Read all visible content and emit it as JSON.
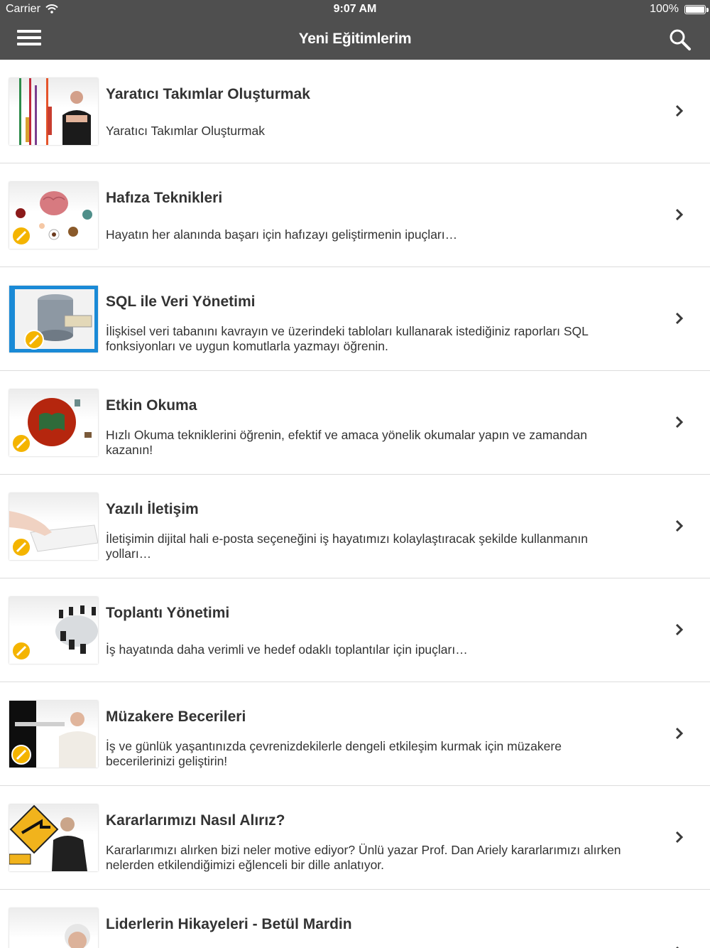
{
  "status_bar": {
    "carrier": "Carrier",
    "time": "9:07 AM",
    "battery": "100%"
  },
  "nav": {
    "title": "Yeni Eğitimlerim",
    "menu_icon": "hamburger-menu-icon",
    "search_icon": "search-icon"
  },
  "courses": [
    {
      "title": "Yaratıcı Takımlar Oluşturmak",
      "description": "Yaratıcı Takımlar Oluşturmak",
      "thumb": "creative-teams-thumbnail"
    },
    {
      "title": "Hafıza Teknikleri",
      "description": "Hayatın her alanında başarı için hafızayı geliştirmenin ipuçları…",
      "thumb": "memory-techniques-thumbnail"
    },
    {
      "title": "SQL ile Veri Yönetimi",
      "description": "İlişkisel veri tabanını kavrayın ve üzerindeki tabloları kullanarak istediğiniz raporları SQL fonksiyonları ve uygun komutlarla yazmayı öğrenin.",
      "thumb": "sql-database-thumbnail"
    },
    {
      "title": "Etkin Okuma",
      "description": "Hızlı Okuma tekniklerini öğrenin, efektif ve amaca yönelik okumalar yapın ve zamandan kazanın!",
      "thumb": "effective-reading-thumbnail"
    },
    {
      "title": "Yazılı İletişim",
      "description": "İletişimin dijital hali e-posta seçeneğini iş hayatımızı kolaylaştıracak şekilde kullanmanın yolları…",
      "thumb": "written-communication-thumbnail"
    },
    {
      "title": "Toplantı Yönetimi",
      "description": "İş hayatında daha verimli ve hedef odaklı toplantılar için ipuçları…",
      "thumb": "meeting-management-thumbnail"
    },
    {
      "title": "Müzakere Becerileri",
      "description": "İş ve günlük yaşantınızda çevrenizdekilerle dengeli etkileşim kurmak için müzakere becerilerinizi geliştirin!",
      "thumb": "negotiation-skills-thumbnail"
    },
    {
      "title": "Kararlarımızı Nasıl Alırız?",
      "description": "Kararlarımızı alırken bizi neler motive ediyor? Ünlü yazar Prof. Dan Ariely kararlarımızı alırken nelerden etkilendiğimizi eğlenceli bir dille anlatıyor.",
      "thumb": "decision-making-thumbnail"
    },
    {
      "title": "Liderlerin Hikayeleri - Betül Mardin",
      "description": "",
      "thumb": "leaders-stories-thumbnail"
    }
  ],
  "icons": {
    "row_chevron": "chevron-right-icon",
    "badge": "tools-badge-icon",
    "wifi": "wifi-icon",
    "battery": "battery-icon"
  },
  "colors": {
    "nav_background": "#4f4f4f",
    "text": "#333333",
    "divider": "#dcdcdc",
    "badge": "#f4b400"
  }
}
